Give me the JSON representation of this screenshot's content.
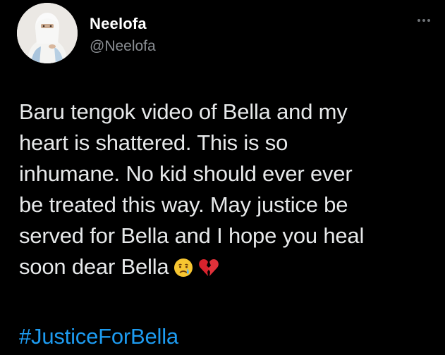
{
  "user": {
    "display_name": "Neelofa",
    "handle": "@Neelofa",
    "avatar_icon": "profile-photo-veiled-woman"
  },
  "menu": {
    "icon": "more-options-icon"
  },
  "tweet": {
    "lines": [
      "Baru tengok video of Bella and my",
      "heart is shattered. This is so",
      "inhumane. No kid should ever ever",
      "be treated this way. May justice be",
      "served for Bella and I hope you heal",
      "soon dear Bella"
    ],
    "emojis": [
      "crying-face-emoji",
      "broken-heart-emoji"
    ],
    "hashtag": "#JusticeForBella"
  },
  "colors": {
    "background": "#000000",
    "text": "#e7e9ea",
    "secondary_text": "#8b8f94",
    "link": "#1d9bf0"
  }
}
